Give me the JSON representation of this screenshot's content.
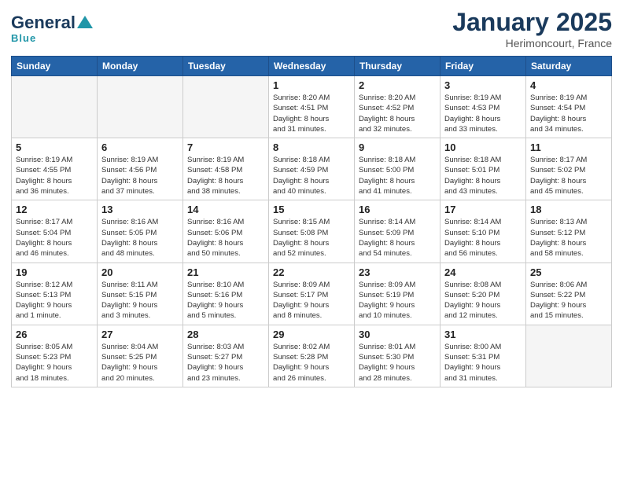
{
  "header": {
    "logo_general": "General",
    "logo_blue": "Blue",
    "month_title": "January 2025",
    "location": "Herimoncourt, France"
  },
  "days_of_week": [
    "Sunday",
    "Monday",
    "Tuesday",
    "Wednesday",
    "Thursday",
    "Friday",
    "Saturday"
  ],
  "weeks": [
    [
      {
        "day": "",
        "info": ""
      },
      {
        "day": "",
        "info": ""
      },
      {
        "day": "",
        "info": ""
      },
      {
        "day": "1",
        "info": "Sunrise: 8:20 AM\nSunset: 4:51 PM\nDaylight: 8 hours\nand 31 minutes."
      },
      {
        "day": "2",
        "info": "Sunrise: 8:20 AM\nSunset: 4:52 PM\nDaylight: 8 hours\nand 32 minutes."
      },
      {
        "day": "3",
        "info": "Sunrise: 8:19 AM\nSunset: 4:53 PM\nDaylight: 8 hours\nand 33 minutes."
      },
      {
        "day": "4",
        "info": "Sunrise: 8:19 AM\nSunset: 4:54 PM\nDaylight: 8 hours\nand 34 minutes."
      }
    ],
    [
      {
        "day": "5",
        "info": "Sunrise: 8:19 AM\nSunset: 4:55 PM\nDaylight: 8 hours\nand 36 minutes."
      },
      {
        "day": "6",
        "info": "Sunrise: 8:19 AM\nSunset: 4:56 PM\nDaylight: 8 hours\nand 37 minutes."
      },
      {
        "day": "7",
        "info": "Sunrise: 8:19 AM\nSunset: 4:58 PM\nDaylight: 8 hours\nand 38 minutes."
      },
      {
        "day": "8",
        "info": "Sunrise: 8:18 AM\nSunset: 4:59 PM\nDaylight: 8 hours\nand 40 minutes."
      },
      {
        "day": "9",
        "info": "Sunrise: 8:18 AM\nSunset: 5:00 PM\nDaylight: 8 hours\nand 41 minutes."
      },
      {
        "day": "10",
        "info": "Sunrise: 8:18 AM\nSunset: 5:01 PM\nDaylight: 8 hours\nand 43 minutes."
      },
      {
        "day": "11",
        "info": "Sunrise: 8:17 AM\nSunset: 5:02 PM\nDaylight: 8 hours\nand 45 minutes."
      }
    ],
    [
      {
        "day": "12",
        "info": "Sunrise: 8:17 AM\nSunset: 5:04 PM\nDaylight: 8 hours\nand 46 minutes."
      },
      {
        "day": "13",
        "info": "Sunrise: 8:16 AM\nSunset: 5:05 PM\nDaylight: 8 hours\nand 48 minutes."
      },
      {
        "day": "14",
        "info": "Sunrise: 8:16 AM\nSunset: 5:06 PM\nDaylight: 8 hours\nand 50 minutes."
      },
      {
        "day": "15",
        "info": "Sunrise: 8:15 AM\nSunset: 5:08 PM\nDaylight: 8 hours\nand 52 minutes."
      },
      {
        "day": "16",
        "info": "Sunrise: 8:14 AM\nSunset: 5:09 PM\nDaylight: 8 hours\nand 54 minutes."
      },
      {
        "day": "17",
        "info": "Sunrise: 8:14 AM\nSunset: 5:10 PM\nDaylight: 8 hours\nand 56 minutes."
      },
      {
        "day": "18",
        "info": "Sunrise: 8:13 AM\nSunset: 5:12 PM\nDaylight: 8 hours\nand 58 minutes."
      }
    ],
    [
      {
        "day": "19",
        "info": "Sunrise: 8:12 AM\nSunset: 5:13 PM\nDaylight: 9 hours\nand 1 minute."
      },
      {
        "day": "20",
        "info": "Sunrise: 8:11 AM\nSunset: 5:15 PM\nDaylight: 9 hours\nand 3 minutes."
      },
      {
        "day": "21",
        "info": "Sunrise: 8:10 AM\nSunset: 5:16 PM\nDaylight: 9 hours\nand 5 minutes."
      },
      {
        "day": "22",
        "info": "Sunrise: 8:09 AM\nSunset: 5:17 PM\nDaylight: 9 hours\nand 8 minutes."
      },
      {
        "day": "23",
        "info": "Sunrise: 8:09 AM\nSunset: 5:19 PM\nDaylight: 9 hours\nand 10 minutes."
      },
      {
        "day": "24",
        "info": "Sunrise: 8:08 AM\nSunset: 5:20 PM\nDaylight: 9 hours\nand 12 minutes."
      },
      {
        "day": "25",
        "info": "Sunrise: 8:06 AM\nSunset: 5:22 PM\nDaylight: 9 hours\nand 15 minutes."
      }
    ],
    [
      {
        "day": "26",
        "info": "Sunrise: 8:05 AM\nSunset: 5:23 PM\nDaylight: 9 hours\nand 18 minutes."
      },
      {
        "day": "27",
        "info": "Sunrise: 8:04 AM\nSunset: 5:25 PM\nDaylight: 9 hours\nand 20 minutes."
      },
      {
        "day": "28",
        "info": "Sunrise: 8:03 AM\nSunset: 5:27 PM\nDaylight: 9 hours\nand 23 minutes."
      },
      {
        "day": "29",
        "info": "Sunrise: 8:02 AM\nSunset: 5:28 PM\nDaylight: 9 hours\nand 26 minutes."
      },
      {
        "day": "30",
        "info": "Sunrise: 8:01 AM\nSunset: 5:30 PM\nDaylight: 9 hours\nand 28 minutes."
      },
      {
        "day": "31",
        "info": "Sunrise: 8:00 AM\nSunset: 5:31 PM\nDaylight: 9 hours\nand 31 minutes."
      },
      {
        "day": "",
        "info": ""
      }
    ]
  ]
}
